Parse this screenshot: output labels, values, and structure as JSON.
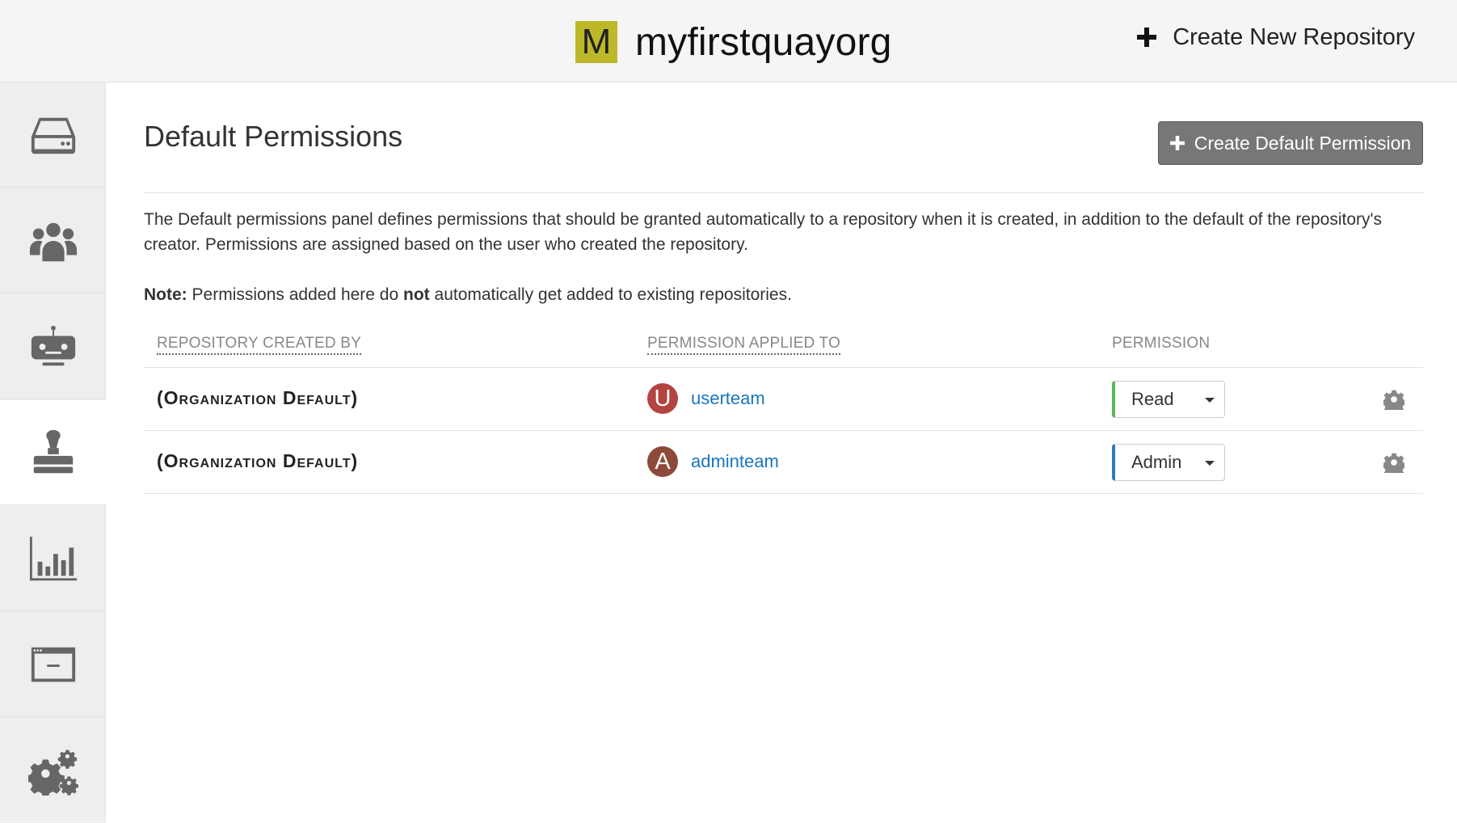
{
  "header": {
    "org_initial": "M",
    "org_name": "myfirstquayorg",
    "create_repo_label": "Create New Repository",
    "org_avatar_color": "#bdb82a"
  },
  "sidebar": {
    "items": [
      {
        "icon": "hdd-icon",
        "active": false
      },
      {
        "icon": "users-icon",
        "active": false
      },
      {
        "icon": "robot-icon",
        "active": false
      },
      {
        "icon": "stamp-icon",
        "active": true
      },
      {
        "icon": "bar-chart-icon",
        "active": false
      },
      {
        "icon": "application-window-icon",
        "active": false
      },
      {
        "icon": "gears-icon",
        "active": false
      }
    ]
  },
  "main": {
    "title": "Default Permissions",
    "create_button_label": "Create Default Permission",
    "description": "The Default permissions panel defines permissions that should be granted automatically to a repository when it is created, in addition to the default of the repository's creator. Permissions are assigned based on the user who created the repository.",
    "note": {
      "label": "Note:",
      "text_before": "Permissions added here do",
      "emphasis": "not",
      "text_after": "automatically get added to existing repositories."
    },
    "table": {
      "headers": [
        "Repository Created By",
        "Permission Applied To",
        "Permission"
      ],
      "rows": [
        {
          "created_by": "(Organization Default)",
          "entity_initial": "U",
          "entity_name": "userteam",
          "entity_color": "#b34442",
          "permission": "Read",
          "permission_color": "#5cb85c"
        },
        {
          "created_by": "(Organization Default)",
          "entity_initial": "A",
          "entity_name": "adminteam",
          "entity_color": "#8c4a3b",
          "permission": "Admin",
          "permission_color": "#337ab7"
        }
      ]
    }
  }
}
